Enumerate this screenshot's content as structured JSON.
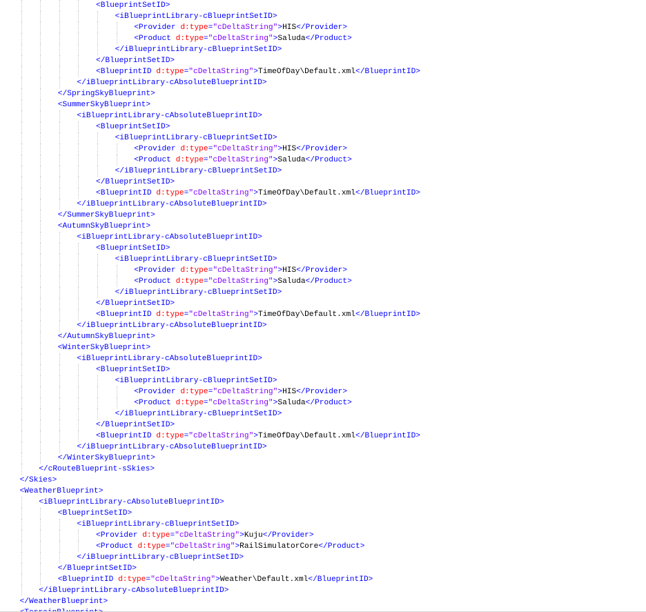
{
  "editor": {
    "lines": [
      {
        "indent": 5,
        "tokens": [
          {
            "t": "tag",
            "v": "<BlueprintSetID>"
          }
        ]
      },
      {
        "indent": 6,
        "tokens": [
          {
            "t": "tag",
            "v": "<iBlueprintLibrary-cBlueprintSetID>"
          }
        ]
      },
      {
        "indent": 7,
        "tokens": [
          {
            "t": "tag",
            "v": "<Provider "
          },
          {
            "t": "attr",
            "v": "d:type"
          },
          {
            "t": "punct",
            "v": "="
          },
          {
            "t": "val",
            "v": "\"cDeltaString\""
          },
          {
            "t": "tag",
            "v": ">"
          },
          {
            "t": "text",
            "v": "HIS"
          },
          {
            "t": "tag",
            "v": "</Provider>"
          }
        ]
      },
      {
        "indent": 7,
        "tokens": [
          {
            "t": "tag",
            "v": "<Product "
          },
          {
            "t": "attr",
            "v": "d:type"
          },
          {
            "t": "punct",
            "v": "="
          },
          {
            "t": "val",
            "v": "\"cDeltaString\""
          },
          {
            "t": "tag",
            "v": ">"
          },
          {
            "t": "text",
            "v": "Saluda"
          },
          {
            "t": "tag",
            "v": "</Product>"
          }
        ]
      },
      {
        "indent": 6,
        "tokens": [
          {
            "t": "tag",
            "v": "</iBlueprintLibrary-cBlueprintSetID>"
          }
        ]
      },
      {
        "indent": 5,
        "tokens": [
          {
            "t": "tag",
            "v": "</BlueprintSetID>"
          }
        ]
      },
      {
        "indent": 5,
        "tokens": [
          {
            "t": "tag",
            "v": "<BlueprintID "
          },
          {
            "t": "attr",
            "v": "d:type"
          },
          {
            "t": "punct",
            "v": "="
          },
          {
            "t": "val",
            "v": "\"cDeltaString\""
          },
          {
            "t": "tag",
            "v": ">"
          },
          {
            "t": "text",
            "v": "TimeOfDay\\Default.xml"
          },
          {
            "t": "tag",
            "v": "</BlueprintID>"
          }
        ]
      },
      {
        "indent": 4,
        "tokens": [
          {
            "t": "tag",
            "v": "</iBlueprintLibrary-cAbsoluteBlueprintID>"
          }
        ]
      },
      {
        "indent": 3,
        "tokens": [
          {
            "t": "tag",
            "v": "</SpringSkyBlueprint>"
          }
        ]
      },
      {
        "indent": 3,
        "tokens": [
          {
            "t": "tag",
            "v": "<SummerSkyBlueprint>"
          }
        ]
      },
      {
        "indent": 4,
        "tokens": [
          {
            "t": "tag",
            "v": "<iBlueprintLibrary-cAbsoluteBlueprintID>"
          }
        ]
      },
      {
        "indent": 5,
        "tokens": [
          {
            "t": "tag",
            "v": "<BlueprintSetID>"
          }
        ]
      },
      {
        "indent": 6,
        "tokens": [
          {
            "t": "tag",
            "v": "<iBlueprintLibrary-cBlueprintSetID>"
          }
        ]
      },
      {
        "indent": 7,
        "tokens": [
          {
            "t": "tag",
            "v": "<Provider "
          },
          {
            "t": "attr",
            "v": "d:type"
          },
          {
            "t": "punct",
            "v": "="
          },
          {
            "t": "val",
            "v": "\"cDeltaString\""
          },
          {
            "t": "tag",
            "v": ">"
          },
          {
            "t": "text",
            "v": "HIS"
          },
          {
            "t": "tag",
            "v": "</Provider>"
          }
        ]
      },
      {
        "indent": 7,
        "tokens": [
          {
            "t": "tag",
            "v": "<Product "
          },
          {
            "t": "attr",
            "v": "d:type"
          },
          {
            "t": "punct",
            "v": "="
          },
          {
            "t": "val",
            "v": "\"cDeltaString\""
          },
          {
            "t": "tag",
            "v": ">"
          },
          {
            "t": "text",
            "v": "Saluda"
          },
          {
            "t": "tag",
            "v": "</Product>"
          }
        ]
      },
      {
        "indent": 6,
        "tokens": [
          {
            "t": "tag",
            "v": "</iBlueprintLibrary-cBlueprintSetID>"
          }
        ]
      },
      {
        "indent": 5,
        "tokens": [
          {
            "t": "tag",
            "v": "</BlueprintSetID>"
          }
        ]
      },
      {
        "indent": 5,
        "tokens": [
          {
            "t": "tag",
            "v": "<BlueprintID "
          },
          {
            "t": "attr",
            "v": "d:type"
          },
          {
            "t": "punct",
            "v": "="
          },
          {
            "t": "val",
            "v": "\"cDeltaString\""
          },
          {
            "t": "tag",
            "v": ">"
          },
          {
            "t": "text",
            "v": "TimeOfDay\\Default.xml"
          },
          {
            "t": "tag",
            "v": "</BlueprintID>"
          }
        ]
      },
      {
        "indent": 4,
        "tokens": [
          {
            "t": "tag",
            "v": "</iBlueprintLibrary-cAbsoluteBlueprintID>"
          }
        ]
      },
      {
        "indent": 3,
        "tokens": [
          {
            "t": "tag",
            "v": "</SummerSkyBlueprint>"
          }
        ]
      },
      {
        "indent": 3,
        "tokens": [
          {
            "t": "tag",
            "v": "<AutumnSkyBlueprint>"
          }
        ]
      },
      {
        "indent": 4,
        "tokens": [
          {
            "t": "tag",
            "v": "<iBlueprintLibrary-cAbsoluteBlueprintID>"
          }
        ]
      },
      {
        "indent": 5,
        "tokens": [
          {
            "t": "tag",
            "v": "<BlueprintSetID>"
          }
        ]
      },
      {
        "indent": 6,
        "tokens": [
          {
            "t": "tag",
            "v": "<iBlueprintLibrary-cBlueprintSetID>"
          }
        ]
      },
      {
        "indent": 7,
        "tokens": [
          {
            "t": "tag",
            "v": "<Provider "
          },
          {
            "t": "attr",
            "v": "d:type"
          },
          {
            "t": "punct",
            "v": "="
          },
          {
            "t": "val",
            "v": "\"cDeltaString\""
          },
          {
            "t": "tag",
            "v": ">"
          },
          {
            "t": "text",
            "v": "HIS"
          },
          {
            "t": "tag",
            "v": "</Provider>"
          }
        ]
      },
      {
        "indent": 7,
        "tokens": [
          {
            "t": "tag",
            "v": "<Product "
          },
          {
            "t": "attr",
            "v": "d:type"
          },
          {
            "t": "punct",
            "v": "="
          },
          {
            "t": "val",
            "v": "\"cDeltaString\""
          },
          {
            "t": "tag",
            "v": ">"
          },
          {
            "t": "text",
            "v": "Saluda"
          },
          {
            "t": "tag",
            "v": "</Product>"
          }
        ]
      },
      {
        "indent": 6,
        "tokens": [
          {
            "t": "tag",
            "v": "</iBlueprintLibrary-cBlueprintSetID>"
          }
        ]
      },
      {
        "indent": 5,
        "tokens": [
          {
            "t": "tag",
            "v": "</BlueprintSetID>"
          }
        ]
      },
      {
        "indent": 5,
        "tokens": [
          {
            "t": "tag",
            "v": "<BlueprintID "
          },
          {
            "t": "attr",
            "v": "d:type"
          },
          {
            "t": "punct",
            "v": "="
          },
          {
            "t": "val",
            "v": "\"cDeltaString\""
          },
          {
            "t": "tag",
            "v": ">"
          },
          {
            "t": "text",
            "v": "TimeOfDay\\Default.xml"
          },
          {
            "t": "tag",
            "v": "</BlueprintID>"
          }
        ]
      },
      {
        "indent": 4,
        "tokens": [
          {
            "t": "tag",
            "v": "</iBlueprintLibrary-cAbsoluteBlueprintID>"
          }
        ]
      },
      {
        "indent": 3,
        "tokens": [
          {
            "t": "tag",
            "v": "</AutumnSkyBlueprint>"
          }
        ]
      },
      {
        "indent": 3,
        "tokens": [
          {
            "t": "tag",
            "v": "<WinterSkyBlueprint>"
          }
        ]
      },
      {
        "indent": 4,
        "tokens": [
          {
            "t": "tag",
            "v": "<iBlueprintLibrary-cAbsoluteBlueprintID>"
          }
        ]
      },
      {
        "indent": 5,
        "tokens": [
          {
            "t": "tag",
            "v": "<BlueprintSetID>"
          }
        ]
      },
      {
        "indent": 6,
        "tokens": [
          {
            "t": "tag",
            "v": "<iBlueprintLibrary-cBlueprintSetID>"
          }
        ]
      },
      {
        "indent": 7,
        "tokens": [
          {
            "t": "tag",
            "v": "<Provider "
          },
          {
            "t": "attr",
            "v": "d:type"
          },
          {
            "t": "punct",
            "v": "="
          },
          {
            "t": "val",
            "v": "\"cDeltaString\""
          },
          {
            "t": "tag",
            "v": ">"
          },
          {
            "t": "text",
            "v": "HIS"
          },
          {
            "t": "tag",
            "v": "</Provider>"
          }
        ]
      },
      {
        "indent": 7,
        "tokens": [
          {
            "t": "tag",
            "v": "<Product "
          },
          {
            "t": "attr",
            "v": "d:type"
          },
          {
            "t": "punct",
            "v": "="
          },
          {
            "t": "val",
            "v": "\"cDeltaString\""
          },
          {
            "t": "tag",
            "v": ">"
          },
          {
            "t": "text",
            "v": "Saluda"
          },
          {
            "t": "tag",
            "v": "</Product>"
          }
        ]
      },
      {
        "indent": 6,
        "tokens": [
          {
            "t": "tag",
            "v": "</iBlueprintLibrary-cBlueprintSetID>"
          }
        ]
      },
      {
        "indent": 5,
        "tokens": [
          {
            "t": "tag",
            "v": "</BlueprintSetID>"
          }
        ]
      },
      {
        "indent": 5,
        "tokens": [
          {
            "t": "tag",
            "v": "<BlueprintID "
          },
          {
            "t": "attr",
            "v": "d:type"
          },
          {
            "t": "punct",
            "v": "="
          },
          {
            "t": "val",
            "v": "\"cDeltaString\""
          },
          {
            "t": "tag",
            "v": ">"
          },
          {
            "t": "text",
            "v": "TimeOfDay\\Default.xml"
          },
          {
            "t": "tag",
            "v": "</BlueprintID>"
          }
        ]
      },
      {
        "indent": 4,
        "tokens": [
          {
            "t": "tag",
            "v": "</iBlueprintLibrary-cAbsoluteBlueprintID>"
          }
        ]
      },
      {
        "indent": 3,
        "tokens": [
          {
            "t": "tag",
            "v": "</WinterSkyBlueprint>"
          }
        ]
      },
      {
        "indent": 2,
        "tokens": [
          {
            "t": "tag",
            "v": "</cRouteBlueprint-sSkies>"
          }
        ]
      },
      {
        "indent": 1,
        "tokens": [
          {
            "t": "tag",
            "v": "</Skies>"
          }
        ]
      },
      {
        "indent": 1,
        "tokens": [
          {
            "t": "tag",
            "v": "<WeatherBlueprint>"
          }
        ]
      },
      {
        "indent": 2,
        "tokens": [
          {
            "t": "tag",
            "v": "<iBlueprintLibrary-cAbsoluteBlueprintID>"
          }
        ]
      },
      {
        "indent": 3,
        "tokens": [
          {
            "t": "tag",
            "v": "<BlueprintSetID>"
          }
        ]
      },
      {
        "indent": 4,
        "tokens": [
          {
            "t": "tag",
            "v": "<iBlueprintLibrary-cBlueprintSetID>"
          }
        ]
      },
      {
        "indent": 5,
        "tokens": [
          {
            "t": "tag",
            "v": "<Provider "
          },
          {
            "t": "attr",
            "v": "d:type"
          },
          {
            "t": "punct",
            "v": "="
          },
          {
            "t": "val",
            "v": "\"cDeltaString\""
          },
          {
            "t": "tag",
            "v": ">"
          },
          {
            "t": "text",
            "v": "Kuju"
          },
          {
            "t": "tag",
            "v": "</Provider>"
          }
        ]
      },
      {
        "indent": 5,
        "tokens": [
          {
            "t": "tag",
            "v": "<Product "
          },
          {
            "t": "attr",
            "v": "d:type"
          },
          {
            "t": "punct",
            "v": "="
          },
          {
            "t": "val",
            "v": "\"cDeltaString\""
          },
          {
            "t": "tag",
            "v": ">"
          },
          {
            "t": "text",
            "v": "RailSimulatorCore"
          },
          {
            "t": "tag",
            "v": "</Product>"
          }
        ]
      },
      {
        "indent": 4,
        "tokens": [
          {
            "t": "tag",
            "v": "</iBlueprintLibrary-cBlueprintSetID>"
          }
        ]
      },
      {
        "indent": 3,
        "tokens": [
          {
            "t": "tag",
            "v": "</BlueprintSetID>"
          }
        ]
      },
      {
        "indent": 3,
        "tokens": [
          {
            "t": "tag",
            "v": "<BlueprintID "
          },
          {
            "t": "attr",
            "v": "d:type"
          },
          {
            "t": "punct",
            "v": "="
          },
          {
            "t": "val",
            "v": "\"cDeltaString\""
          },
          {
            "t": "tag",
            "v": ">"
          },
          {
            "t": "text",
            "v": "Weather\\Default.xml"
          },
          {
            "t": "tag",
            "v": "</BlueprintID>"
          }
        ]
      },
      {
        "indent": 2,
        "tokens": [
          {
            "t": "tag",
            "v": "</iBlueprintLibrary-cAbsoluteBlueprintID>"
          }
        ]
      },
      {
        "indent": 1,
        "tokens": [
          {
            "t": "tag",
            "v": "</WeatherBlueprint>"
          }
        ]
      },
      {
        "indent": 1,
        "tokens": [
          {
            "t": "tag",
            "v": "<TerrainBlueprint>"
          }
        ]
      }
    ]
  },
  "colors": {
    "tag": "#0000ff",
    "attr": "#ff0000",
    "val": "#8000ff",
    "text": "#000000",
    "guide": "#c8c8c8",
    "background": "#ffffff"
  }
}
